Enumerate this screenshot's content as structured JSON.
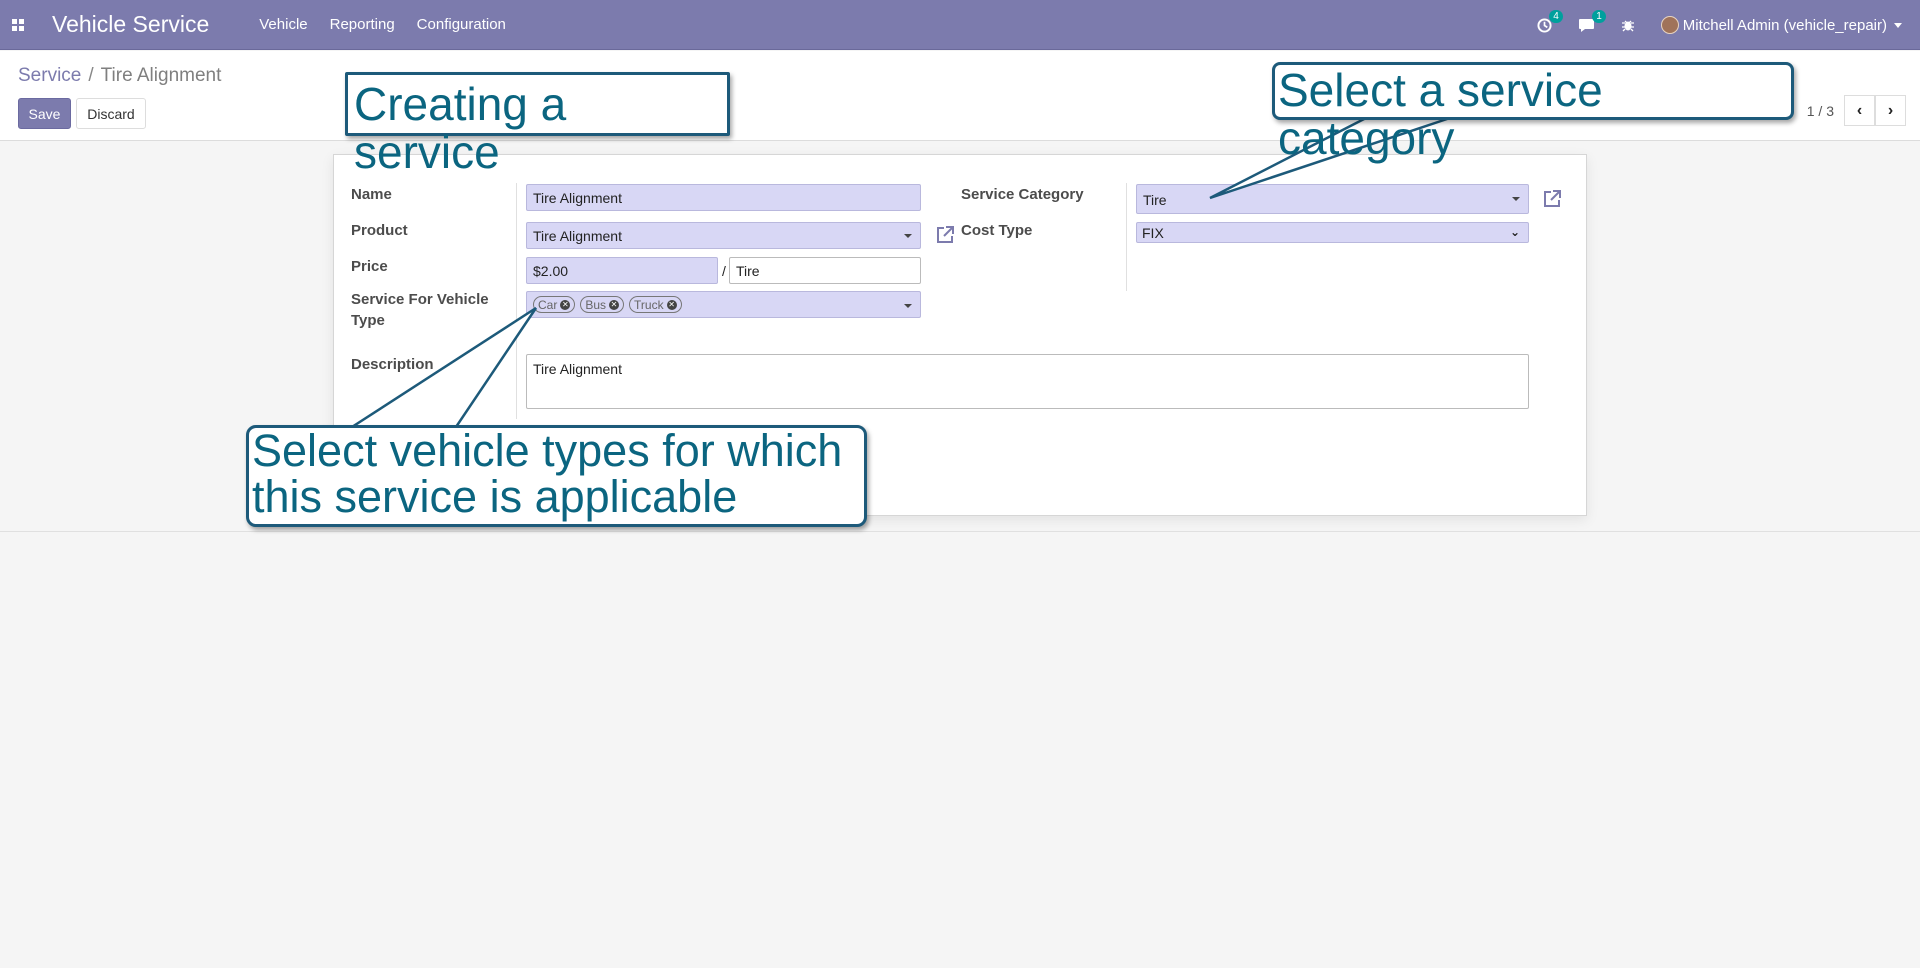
{
  "navbar": {
    "app_title": "Vehicle Service",
    "menu": [
      "Vehicle",
      "Reporting",
      "Configuration"
    ],
    "activity_count": "4",
    "messages_count": "1",
    "user": "Mitchell Admin (vehicle_repair)"
  },
  "breadcrumb": {
    "parent": "Service",
    "separator": "/",
    "current": "Tire Alignment"
  },
  "buttons": {
    "save": "Save",
    "discard": "Discard"
  },
  "pager": {
    "value": "1 / 3"
  },
  "form": {
    "name_label": "Name",
    "name_value": "Tire Alignment",
    "product_label": "Product",
    "product_value": "Tire Alignment",
    "price_label": "Price",
    "price_value": "$2.00",
    "price_sep": "/",
    "price_unit": "Tire",
    "vehicle_type_label_1": "Service For Vehicle",
    "vehicle_type_label_2": "Type",
    "vehicle_types": [
      "Car",
      "Bus",
      "Truck"
    ],
    "category_label": "Service Category",
    "category_value": "Tire",
    "cost_type_label": "Cost Type",
    "cost_type_value": "FIX",
    "description_label": "Description",
    "description_value": "Tire Alignment"
  },
  "annotations": {
    "title": "Creating a service",
    "category_hint": "Select a service category",
    "vehicle_hint_1": "Select vehicle types for which",
    "vehicle_hint_2": "this service is applicable"
  },
  "colors": {
    "navbar": "#7c7bad",
    "field_required": "#d8d7f5",
    "callout_text": "#0b6580",
    "callout_border": "#1d5a7a"
  }
}
